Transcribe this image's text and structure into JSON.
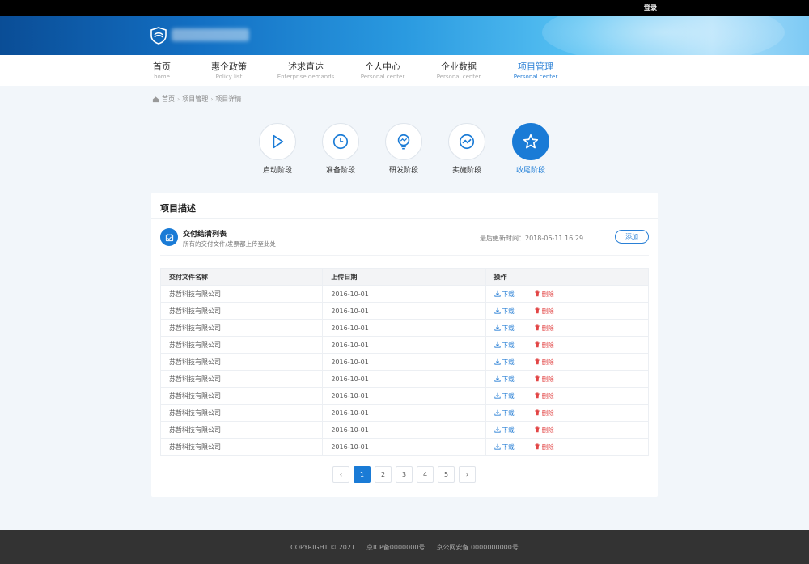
{
  "header": {
    "login": "登录"
  },
  "nav": [
    {
      "zh": "首页",
      "en": "home"
    },
    {
      "zh": "惠企政策",
      "en": "Policy list"
    },
    {
      "zh": "述求直达",
      "en": "Enterprise demands"
    },
    {
      "zh": "个人中心",
      "en": "Personal center"
    },
    {
      "zh": "企业数据",
      "en": "Personal center"
    },
    {
      "zh": "项目管理",
      "en": "Personal center"
    }
  ],
  "breadcrumb": [
    "首页",
    "项目管理",
    "项目详情"
  ],
  "stages": [
    {
      "label": "启动阶段",
      "icon": "play-icon"
    },
    {
      "label": "准备阶段",
      "icon": "clock-icon"
    },
    {
      "label": "研发阶段",
      "icon": "bulb-icon"
    },
    {
      "label": "实施阶段",
      "icon": "trend-icon"
    },
    {
      "label": "收尾阶段",
      "icon": "star-icon"
    }
  ],
  "card": {
    "title": "项目描述",
    "section_title": "交付结清列表",
    "section_desc": "所有的交付文件/发票都上传至此处",
    "update_label": "最后更新时间：2018-06-11 16:29",
    "add_label": "添加"
  },
  "table": {
    "headers": [
      "交付文件名称",
      "上传日期",
      "操作"
    ],
    "download_label": "下载",
    "delete_label": "删除",
    "rows": [
      [
        "苏哲科技有限公司",
        "2016-10-01"
      ],
      [
        "苏哲科技有限公司",
        "2016-10-01"
      ],
      [
        "苏哲科技有限公司",
        "2016-10-01"
      ],
      [
        "苏哲科技有限公司",
        "2016-10-01"
      ],
      [
        "苏哲科技有限公司",
        "2016-10-01"
      ],
      [
        "苏哲科技有限公司",
        "2016-10-01"
      ],
      [
        "苏哲科技有限公司",
        "2016-10-01"
      ],
      [
        "苏哲科技有限公司",
        "2016-10-01"
      ],
      [
        "苏哲科技有限公司",
        "2016-10-01"
      ],
      [
        "苏哲科技有限公司",
        "2016-10-01"
      ]
    ]
  },
  "pagination": {
    "prev": "‹",
    "next": "›",
    "pages": [
      "1",
      "2",
      "3",
      "4",
      "5"
    ]
  },
  "footer": {
    "copyright": "COPYRIGHT © 2021",
    "icp": "京ICP备0000000号",
    "security": "京公网安备 0000000000号"
  }
}
